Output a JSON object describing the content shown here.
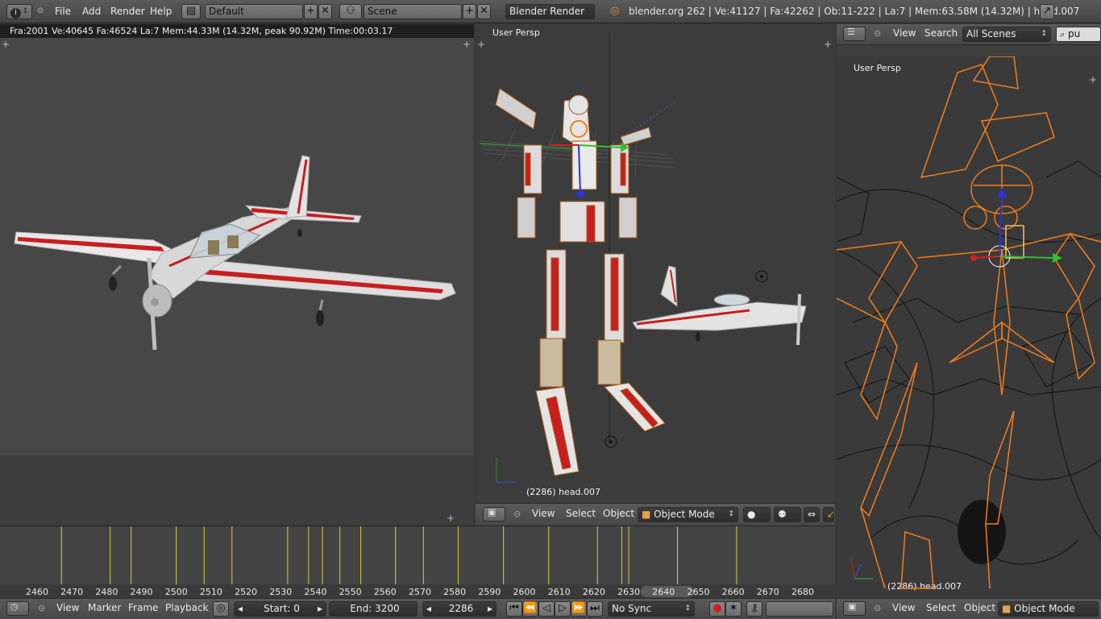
{
  "top_header": {
    "menus": [
      "File",
      "Add",
      "Render",
      "Help"
    ],
    "layout": "Default",
    "scene": "Scene",
    "engine": "Blender Render",
    "stats": "blender.org 262 | Ve:41127 | Fa:42262 | Ob:11-222 | La:7 | Mem:63.58M (14.32M) | head.007",
    "icons": [
      "info-icon",
      "screen-layout-icon",
      "scene-icon",
      "blender-logo-icon",
      "fullscreen-icon"
    ]
  },
  "render_view": {
    "stats": "Fra:2001  Ve:40645 Fa:46524 La:7 Mem:44.33M (14.32M, peak 90.92M) Time:00:03.17"
  },
  "center_view": {
    "label": "User Persp",
    "object_info": "(2286) head.007",
    "header": {
      "menus": [
        "View",
        "Select",
        "Object"
      ],
      "mode": "Object Mode"
    }
  },
  "outliner": {
    "menus": [
      "View",
      "Search"
    ],
    "filter": "All Scenes",
    "search_value": "pu"
  },
  "right_view": {
    "label": "User Persp",
    "object_info": "(2286) head.007",
    "header": {
      "menus": [
        "View",
        "Select",
        "Object"
      ],
      "mode": "Object Mode"
    }
  },
  "timeline": {
    "ruler": [
      "2460",
      "2470",
      "2480",
      "2490",
      "2500",
      "2510",
      "2520",
      "2530",
      "2540",
      "2550",
      "2560",
      "2570",
      "2580",
      "2590",
      "2600",
      "2610",
      "2620",
      "2630",
      "2640",
      "2650",
      "2660",
      "2670",
      "2680"
    ],
    "keyframes": [
      2467,
      2481,
      2487,
      2500,
      2508,
      2516,
      2532,
      2538,
      2542,
      2547,
      2553,
      2563,
      2571,
      2581,
      2594,
      2607,
      2621,
      2628,
      2630,
      2644,
      2661
    ],
    "menus": [
      "View",
      "Marker",
      "Frame",
      "Playback"
    ],
    "start": "Start: 0",
    "end": "End: 3200",
    "current_frame": "2286",
    "sync": "No Sync"
  },
  "colors": {
    "keyframe": "#d6cf37",
    "selection": "#f47e1a",
    "wire": "#000000",
    "plane_stripe": "#c81e1e"
  }
}
